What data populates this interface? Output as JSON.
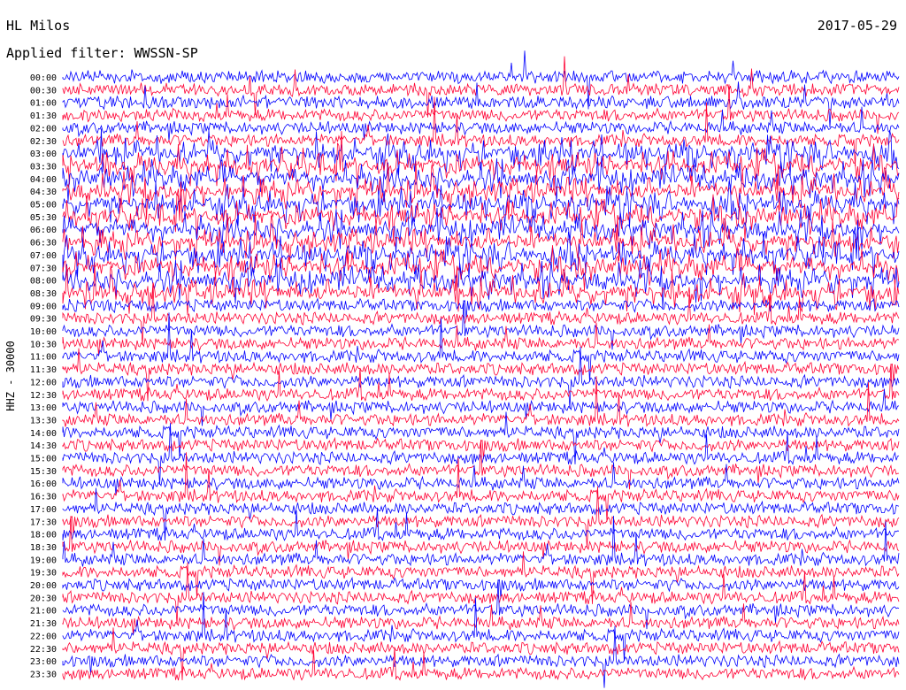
{
  "header": {
    "station": "HL Milos",
    "filter": "Applied filter: WWSSN-SP",
    "date": "2017-05-29"
  },
  "chart_data": {
    "type": "helicorder",
    "title": "HL Milos",
    "date": "2017-05-29",
    "filter": "Applied filter: WWSSN-SP",
    "channel_label": "HHZ - 30000",
    "row_times": [
      "00:00",
      "00:30",
      "01:00",
      "01:30",
      "02:00",
      "02:30",
      "03:00",
      "03:30",
      "04:00",
      "04:30",
      "05:00",
      "05:30",
      "06:00",
      "06:30",
      "07:00",
      "07:30",
      "08:00",
      "08:30",
      "09:00",
      "09:30",
      "10:00",
      "10:30",
      "11:00",
      "11:30",
      "12:00",
      "12:30",
      "13:00",
      "13:30",
      "14:00",
      "14:30",
      "15:00",
      "15:30",
      "16:00",
      "16:30",
      "17:00",
      "17:30",
      "18:00",
      "18:30",
      "19:00",
      "19:30",
      "20:00",
      "20:30",
      "21:00",
      "21:30",
      "22:00",
      "22:30",
      "23:00",
      "23:30"
    ],
    "trace_colors": [
      "#0000ff",
      "#ff0033"
    ],
    "minutes_per_row": 30,
    "grid": false
  }
}
